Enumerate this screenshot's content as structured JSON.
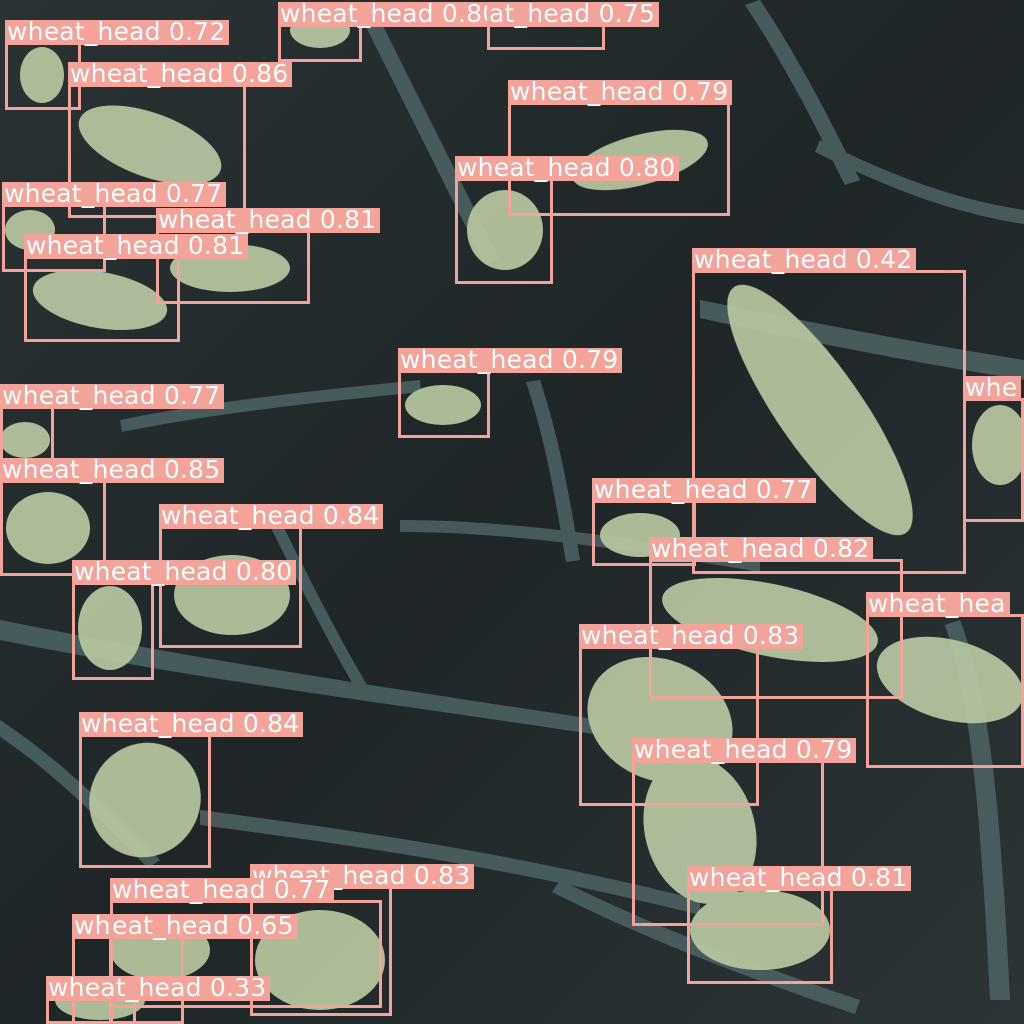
{
  "image": {
    "subject": "wheat field close-up with object detection boxes",
    "box_color": "#f4a39b",
    "label_text_color": "#ffffff"
  },
  "detections": [
    {
      "label": "wheat_head 0.80"
    },
    {
      "label": "at_head 0.75"
    },
    {
      "label": "wheat_head 0.72"
    },
    {
      "label": "wheat_head 0.86"
    },
    {
      "label": "wheat_head 0.79"
    },
    {
      "label": "wheat_head 0.80"
    },
    {
      "label": "wheat_head 0.77"
    },
    {
      "label": "wheat_head 0.81"
    },
    {
      "label": "wheat_head 0.81"
    },
    {
      "label": "wheat_head 0.42"
    },
    {
      "label": "whe"
    },
    {
      "label": "wheat_head 0.79"
    },
    {
      "label": "wheat_head 0.77"
    },
    {
      "label": "wheat_head 0.85"
    },
    {
      "label": "wheat_head 0.84"
    },
    {
      "label": "wheat_head 0.77"
    },
    {
      "label": "wheat_head 0.82"
    },
    {
      "label": "wheat_head 0.80"
    },
    {
      "label": "wheat_hea"
    },
    {
      "label": "wheat_head 0.83"
    },
    {
      "label": "wheat_head 0.84"
    },
    {
      "label": "wheat_head 0.79"
    },
    {
      "label": "wheat_head 0.83"
    },
    {
      "label": "wheat_head 0.77"
    },
    {
      "label": "wheat_head 0.81"
    },
    {
      "label": "wh"
    },
    {
      "label": "eat_head 0.65"
    },
    {
      "label": "wheat_head 0.33"
    }
  ]
}
